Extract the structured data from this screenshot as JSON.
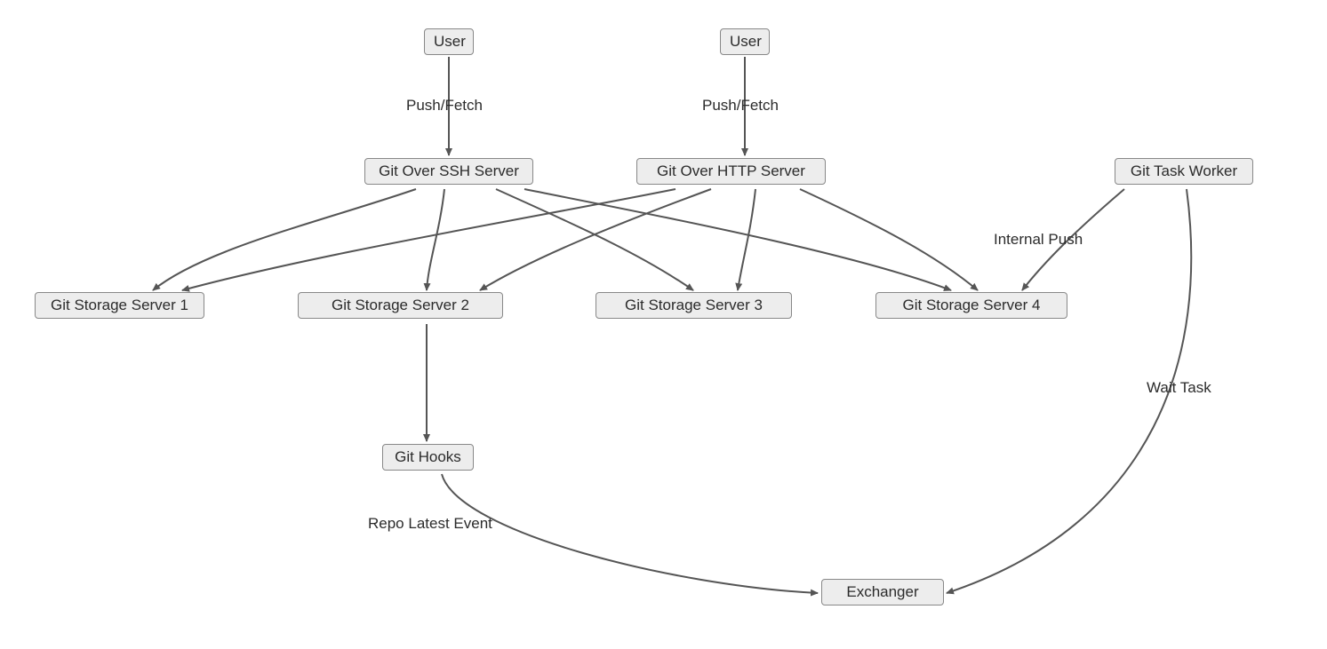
{
  "nodes": {
    "user1": "User",
    "user2": "User",
    "ssh": "Git Over SSH Server",
    "http": "Git Over HTTP Server",
    "taskWorker": "Git Task Worker",
    "storage1": "Git Storage Server 1",
    "storage2": "Git Storage Server 2",
    "storage3": "Git Storage Server 3",
    "storage4": "Git Storage Server 4",
    "hooks": "Git Hooks",
    "exchanger": "Exchanger"
  },
  "labels": {
    "pushFetch1": "Push/Fetch",
    "pushFetch2": "Push/Fetch",
    "internalPush": "Internal Push",
    "waitTask": "Wait Task",
    "repoEvent": "Repo Latest Event"
  }
}
